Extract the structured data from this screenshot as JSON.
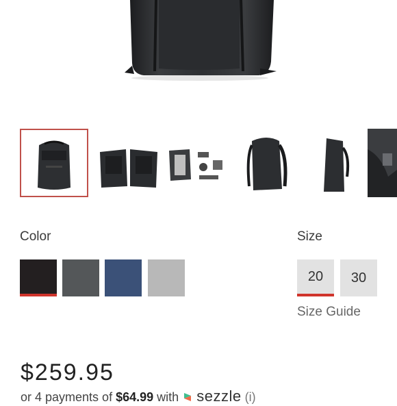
{
  "hero": {
    "alt": "backpack"
  },
  "thumbnails": [
    {
      "name": "thumb-front",
      "selected": true
    },
    {
      "name": "thumb-open-pair",
      "selected": false
    },
    {
      "name": "thumb-accessories",
      "selected": false
    },
    {
      "name": "thumb-side",
      "selected": false
    },
    {
      "name": "thumb-profile",
      "selected": false
    },
    {
      "name": "thumb-detail",
      "selected": false
    }
  ],
  "color": {
    "label": "Color",
    "options": [
      {
        "name": "black",
        "hex": "#231f20",
        "selected": true
      },
      {
        "name": "charcoal",
        "hex": "#545759",
        "selected": false
      },
      {
        "name": "midnight",
        "hex": "#3b5178",
        "selected": false
      },
      {
        "name": "ash",
        "hex": "#b8b8b8",
        "selected": false
      }
    ],
    "accent": "#d0342c"
  },
  "size": {
    "label": "Size",
    "options": [
      "20",
      "30"
    ],
    "selected": "20",
    "guide_label": "Size Guide"
  },
  "price": "$259.95",
  "payments": {
    "prefix": "or 4 payments of",
    "amount": "$64.99",
    "with": "with",
    "provider": "sezzle",
    "info": "(i)"
  }
}
